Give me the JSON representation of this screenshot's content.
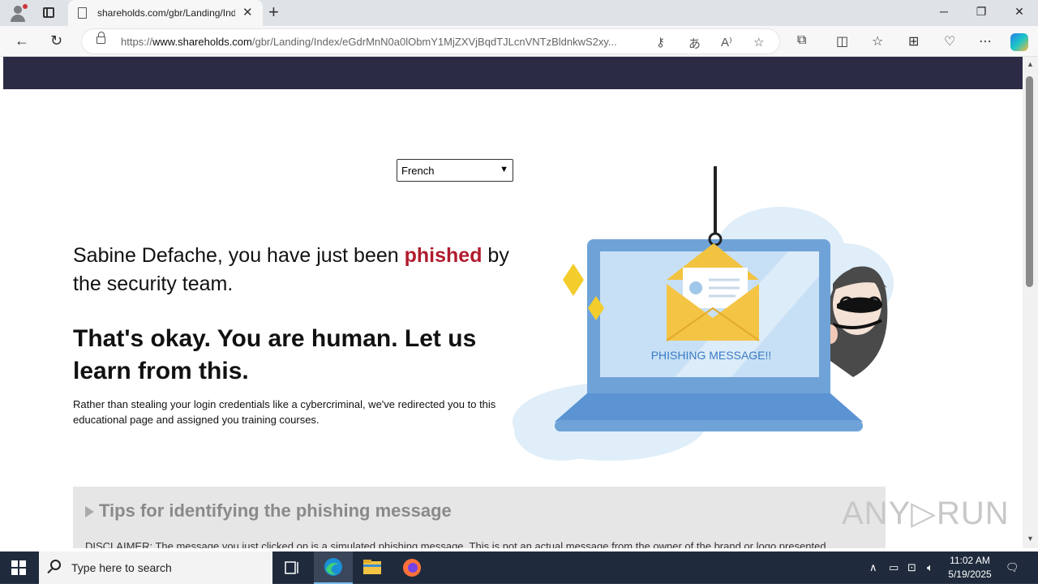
{
  "browser": {
    "tab_title": "shareholds.com/gbr/Landing/Ind",
    "tab_close": "✕",
    "new_tab": "+",
    "window_controls": {
      "minimize": "─",
      "restore": "❐",
      "close": "✕"
    },
    "url_prefix": "https://",
    "url_host": "www.shareholds.com",
    "url_path": "/gbr/Landing/Index/eGdrMnN0a0lObmY1MjZXVjBqdTJLcnVNTzBldnkwS2xy...",
    "icons": [
      "back-icon",
      "refresh-icon",
      "lock-icon",
      "key-icon",
      "translate-icon",
      "read-aloud-icon",
      "favorite-star-icon",
      "extensions-icon",
      "split-screen-icon",
      "favorites-icon",
      "collections-icon",
      "performance-icon",
      "more-icon",
      "copilot-icon"
    ]
  },
  "page": {
    "language_select": {
      "selected": "French"
    },
    "greeting_pre": "Sabine Defache, you have just been ",
    "greeting_phished": "phished",
    "greeting_post": " by the security team.",
    "headline": "That's okay. You are human. Let us learn from this.",
    "description": "Rather than stealing your login credentials like a cybercriminal, we've redirected you to this educational page and assigned you training courses.",
    "illustration_caption": "PHISHING MESSAGE!!",
    "tips_title": "Tips for identifying the phishing message",
    "disclaimer": "DISCLAIMER: The message you just clicked on is a simulated phishing message. This is not an actual message from the owner of the brand or logo presented."
  },
  "watermark": "ANY▷RUN",
  "taskbar": {
    "search_placeholder": "Type here to search",
    "time": "11:02 AM",
    "date": "5/19/2025"
  },
  "colors": {
    "header": "#2b2b45",
    "phished_red": "#b01c2e",
    "taskbar": "#1f2b3d"
  }
}
